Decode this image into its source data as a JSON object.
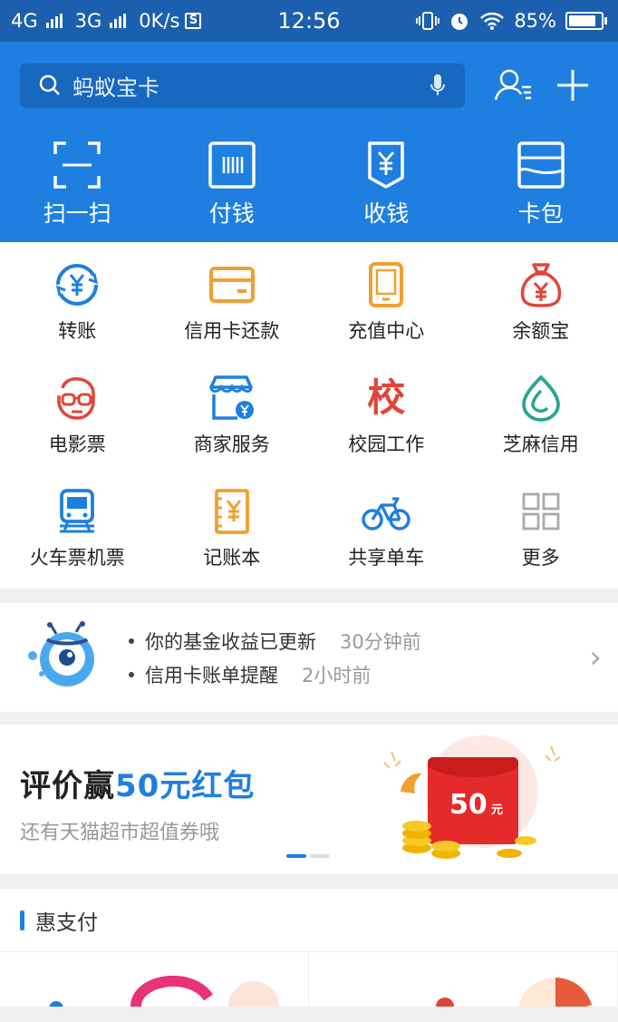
{
  "status_bar": {
    "network1": "4G",
    "network2": "3G",
    "speed": "0K/s",
    "s_badge": "S",
    "time": "12:56",
    "battery": "85%",
    "battery_level": 0.85
  },
  "search": {
    "placeholder": "蚂蚁宝卡"
  },
  "quick_actions": [
    {
      "label": "扫一扫",
      "icon": "scan-icon"
    },
    {
      "label": "付钱",
      "icon": "barcode-pay-icon"
    },
    {
      "label": "收钱",
      "icon": "receive-money-icon"
    },
    {
      "label": "卡包",
      "icon": "card-wallet-icon"
    }
  ],
  "grid": [
    {
      "label": "转账",
      "icon": "transfer-icon"
    },
    {
      "label": "信用卡还款",
      "icon": "credit-card-icon"
    },
    {
      "label": "充值中心",
      "icon": "phone-recharge-icon"
    },
    {
      "label": "余额宝",
      "icon": "money-bag-icon"
    },
    {
      "label": "电影票",
      "icon": "movie-glasses-icon"
    },
    {
      "label": "商家服务",
      "icon": "shop-icon"
    },
    {
      "label": "校园工作",
      "icon": "campus-icon",
      "glyph": "校"
    },
    {
      "label": "芝麻信用",
      "icon": "sesame-credit-icon"
    },
    {
      "label": "火车票机票",
      "icon": "train-icon"
    },
    {
      "label": "记账本",
      "icon": "ledger-icon"
    },
    {
      "label": "共享单车",
      "icon": "bicycle-icon"
    },
    {
      "label": "更多",
      "icon": "more-grid-icon"
    }
  ],
  "notice": {
    "items": [
      {
        "text": "你的基金收益已更新",
        "time": "30分钟前"
      },
      {
        "text": "信用卡账单提醒",
        "time": "2小时前"
      }
    ]
  },
  "banner": {
    "title_prefix": "评价赢",
    "title_highlight": "50元红包",
    "subtitle": "还有天猫超市超值券哦",
    "envelope_amount": "50",
    "envelope_unit": "元"
  },
  "hui": {
    "title": "惠支付"
  },
  "colors": {
    "brand_blue": "#1e7fe0",
    "orange": "#f0a030",
    "red": "#e0453a",
    "teal": "#2aa58f"
  }
}
